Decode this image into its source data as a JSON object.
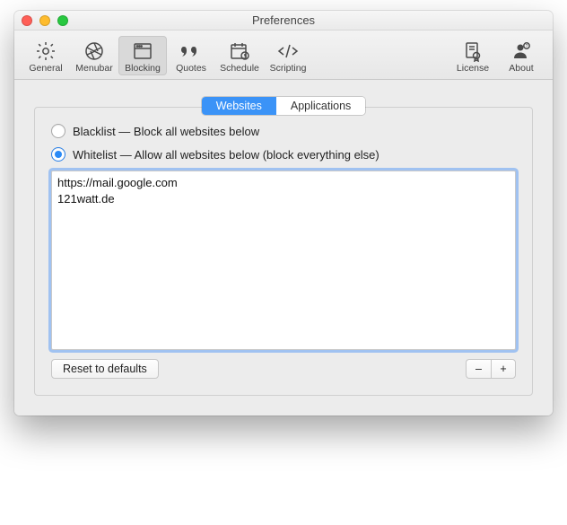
{
  "window": {
    "title": "Preferences"
  },
  "toolbar": {
    "items": {
      "general": {
        "label": "General"
      },
      "menubar": {
        "label": "Menubar"
      },
      "blocking": {
        "label": "Blocking"
      },
      "quotes": {
        "label": "Quotes"
      },
      "schedule": {
        "label": "Schedule"
      },
      "scripting": {
        "label": "Scripting"
      },
      "license": {
        "label": "License"
      },
      "about": {
        "label": "About"
      }
    },
    "active": "blocking"
  },
  "segmented": {
    "websites": "Websites",
    "applications": "Applications",
    "active": "websites"
  },
  "radios": {
    "blacklist": "Blacklist — Block all websites below",
    "whitelist": "Whitelist — Allow all websites below (block everything else)",
    "selected": "whitelist"
  },
  "list": {
    "items": [
      "https://mail.google.com",
      "121watt.de"
    ]
  },
  "buttons": {
    "reset": "Reset to defaults",
    "remove": "–",
    "add": "+"
  }
}
